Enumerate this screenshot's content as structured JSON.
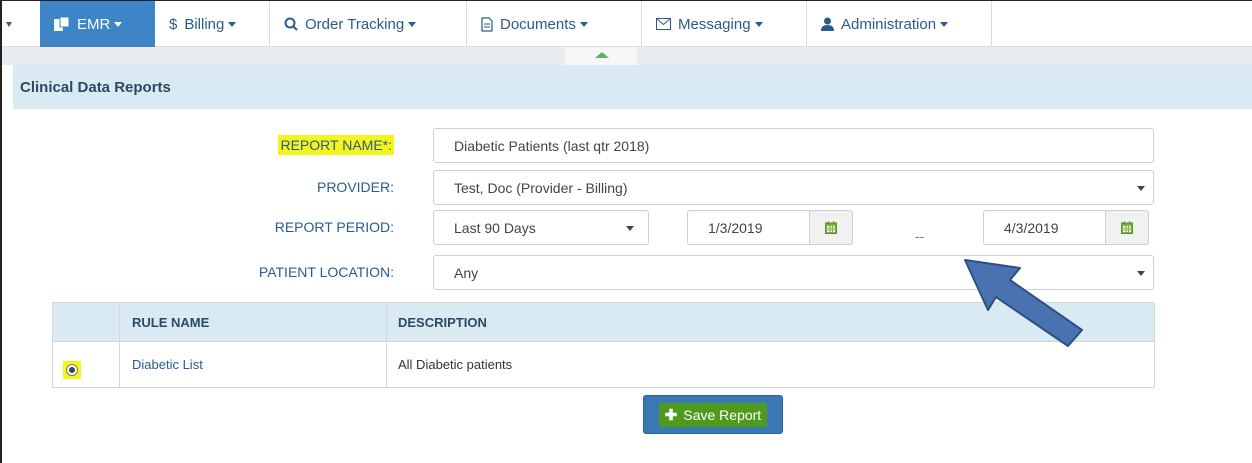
{
  "nav": {
    "items": [
      {
        "label": "EMR",
        "icon": "emr-icon",
        "active": true
      },
      {
        "label": "Billing",
        "icon": "dollar-icon"
      },
      {
        "label": "Order Tracking",
        "icon": "search-icon"
      },
      {
        "label": "Documents",
        "icon": "document-icon"
      },
      {
        "label": "Messaging",
        "icon": "envelope-icon"
      },
      {
        "label": "Administration",
        "icon": "user-icon"
      }
    ]
  },
  "section": {
    "title": "Clinical Data Reports"
  },
  "form": {
    "report_name_label": "REPORT NAME*:",
    "report_name_value": "Diabetic Patients (last qtr 2018)",
    "provider_label": "PROVIDER:",
    "provider_value": "Test, Doc (Provider - Billing)",
    "period_label": "REPORT PERIOD:",
    "period_value": "Last 90 Days",
    "start_date": "1/3/2019",
    "date_separator": "--",
    "end_date": "4/3/2019",
    "location_label": "PATIENT LOCATION:",
    "location_value": "Any"
  },
  "table": {
    "headers": {
      "rule_name": "RULE NAME",
      "description": "DESCRIPTION"
    },
    "rows": [
      {
        "rule_name": "Diabetic List",
        "description": "All Diabetic patients",
        "selected": true
      }
    ]
  },
  "actions": {
    "save_label": "Save Report"
  },
  "colors": {
    "accent": "#3d85c6",
    "header_bg": "#d9eaf3",
    "highlight": "#f3f51d",
    "save_green": "#4e9a1c",
    "arrow": "#4a6fae"
  }
}
